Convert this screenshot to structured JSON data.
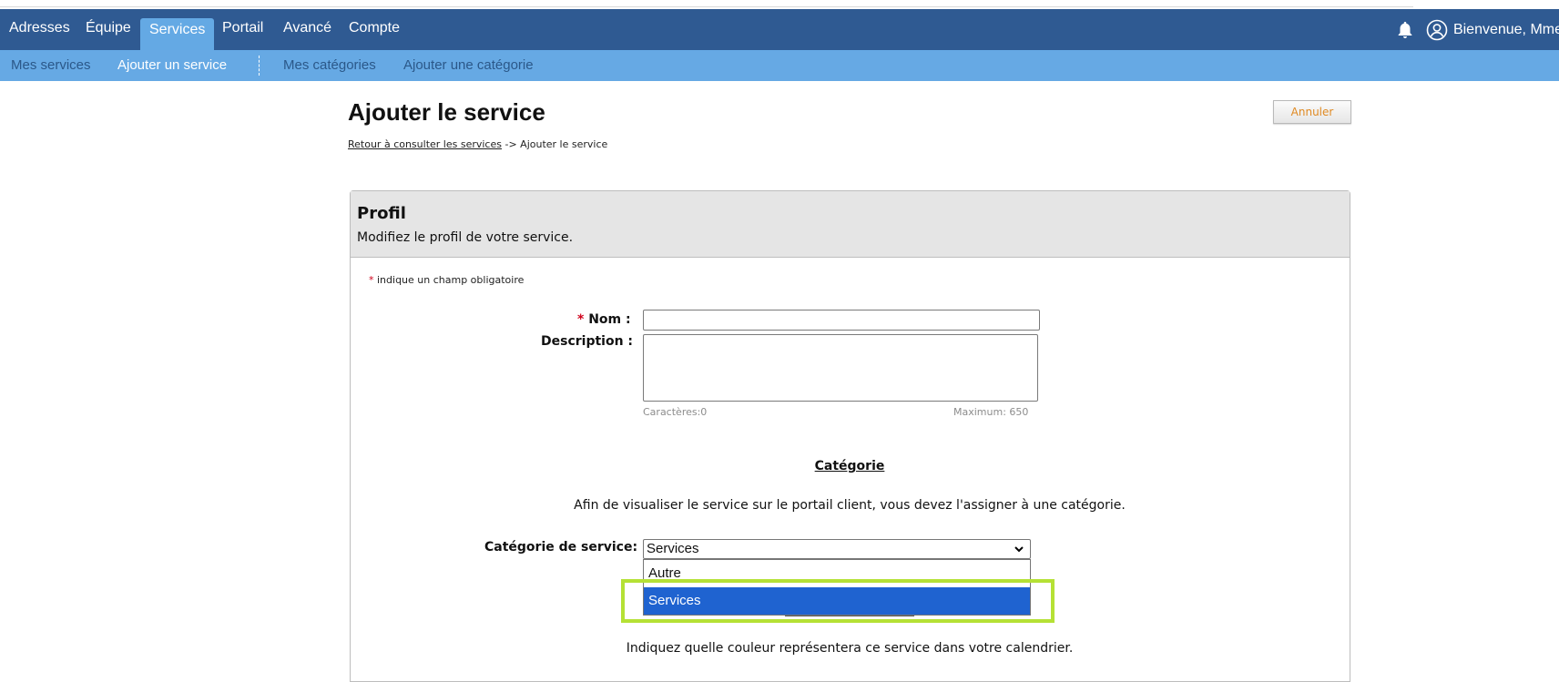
{
  "nav": {
    "items": [
      "Adresses",
      "Équipe",
      "Services",
      "Portail",
      "Avancé",
      "Compte"
    ],
    "active": "Services",
    "welcome": "Bienvenue, Mme"
  },
  "subnav": {
    "items": [
      "Mes services",
      "Ajouter un service",
      "Mes catégories",
      "Ajouter une catégorie"
    ],
    "active": "Ajouter un service"
  },
  "page": {
    "title": "Ajouter le service",
    "cancel_label": "Annuler",
    "breadcrumb_link": "Retour à consulter les services",
    "breadcrumb_current": " -> Ajouter le service"
  },
  "profile": {
    "title": "Profil",
    "subtitle": "Modifiez le profil de votre service.",
    "required_note": " indique un champ obligatoire",
    "required_star": "*",
    "name_label": " Nom :",
    "name_value": "",
    "description_label": "Description :",
    "description_value": "",
    "char_count_label": "Caractères:0",
    "max_label": "Maximum: 650"
  },
  "category": {
    "heading": "Catégorie",
    "description": "Afin de visualiser le service sur le portail client, vous devez l'assigner à une catégorie.",
    "select_label": "Catégorie de service:",
    "selected_value": "Services",
    "options": [
      "Autre",
      "Services"
    ],
    "highlighted_option": "Services"
  },
  "color": {
    "description": "Indiquez quelle couleur représentera ce service dans votre calendrier."
  },
  "colors": {
    "nav_bg": "#2f5a92",
    "subnav_bg": "#66a9e4",
    "active_tab_bg": "#64a9e4",
    "selected_option_bg": "#1f63d0",
    "highlight_border": "#b5e135",
    "cancel_text": "#e08a23"
  }
}
